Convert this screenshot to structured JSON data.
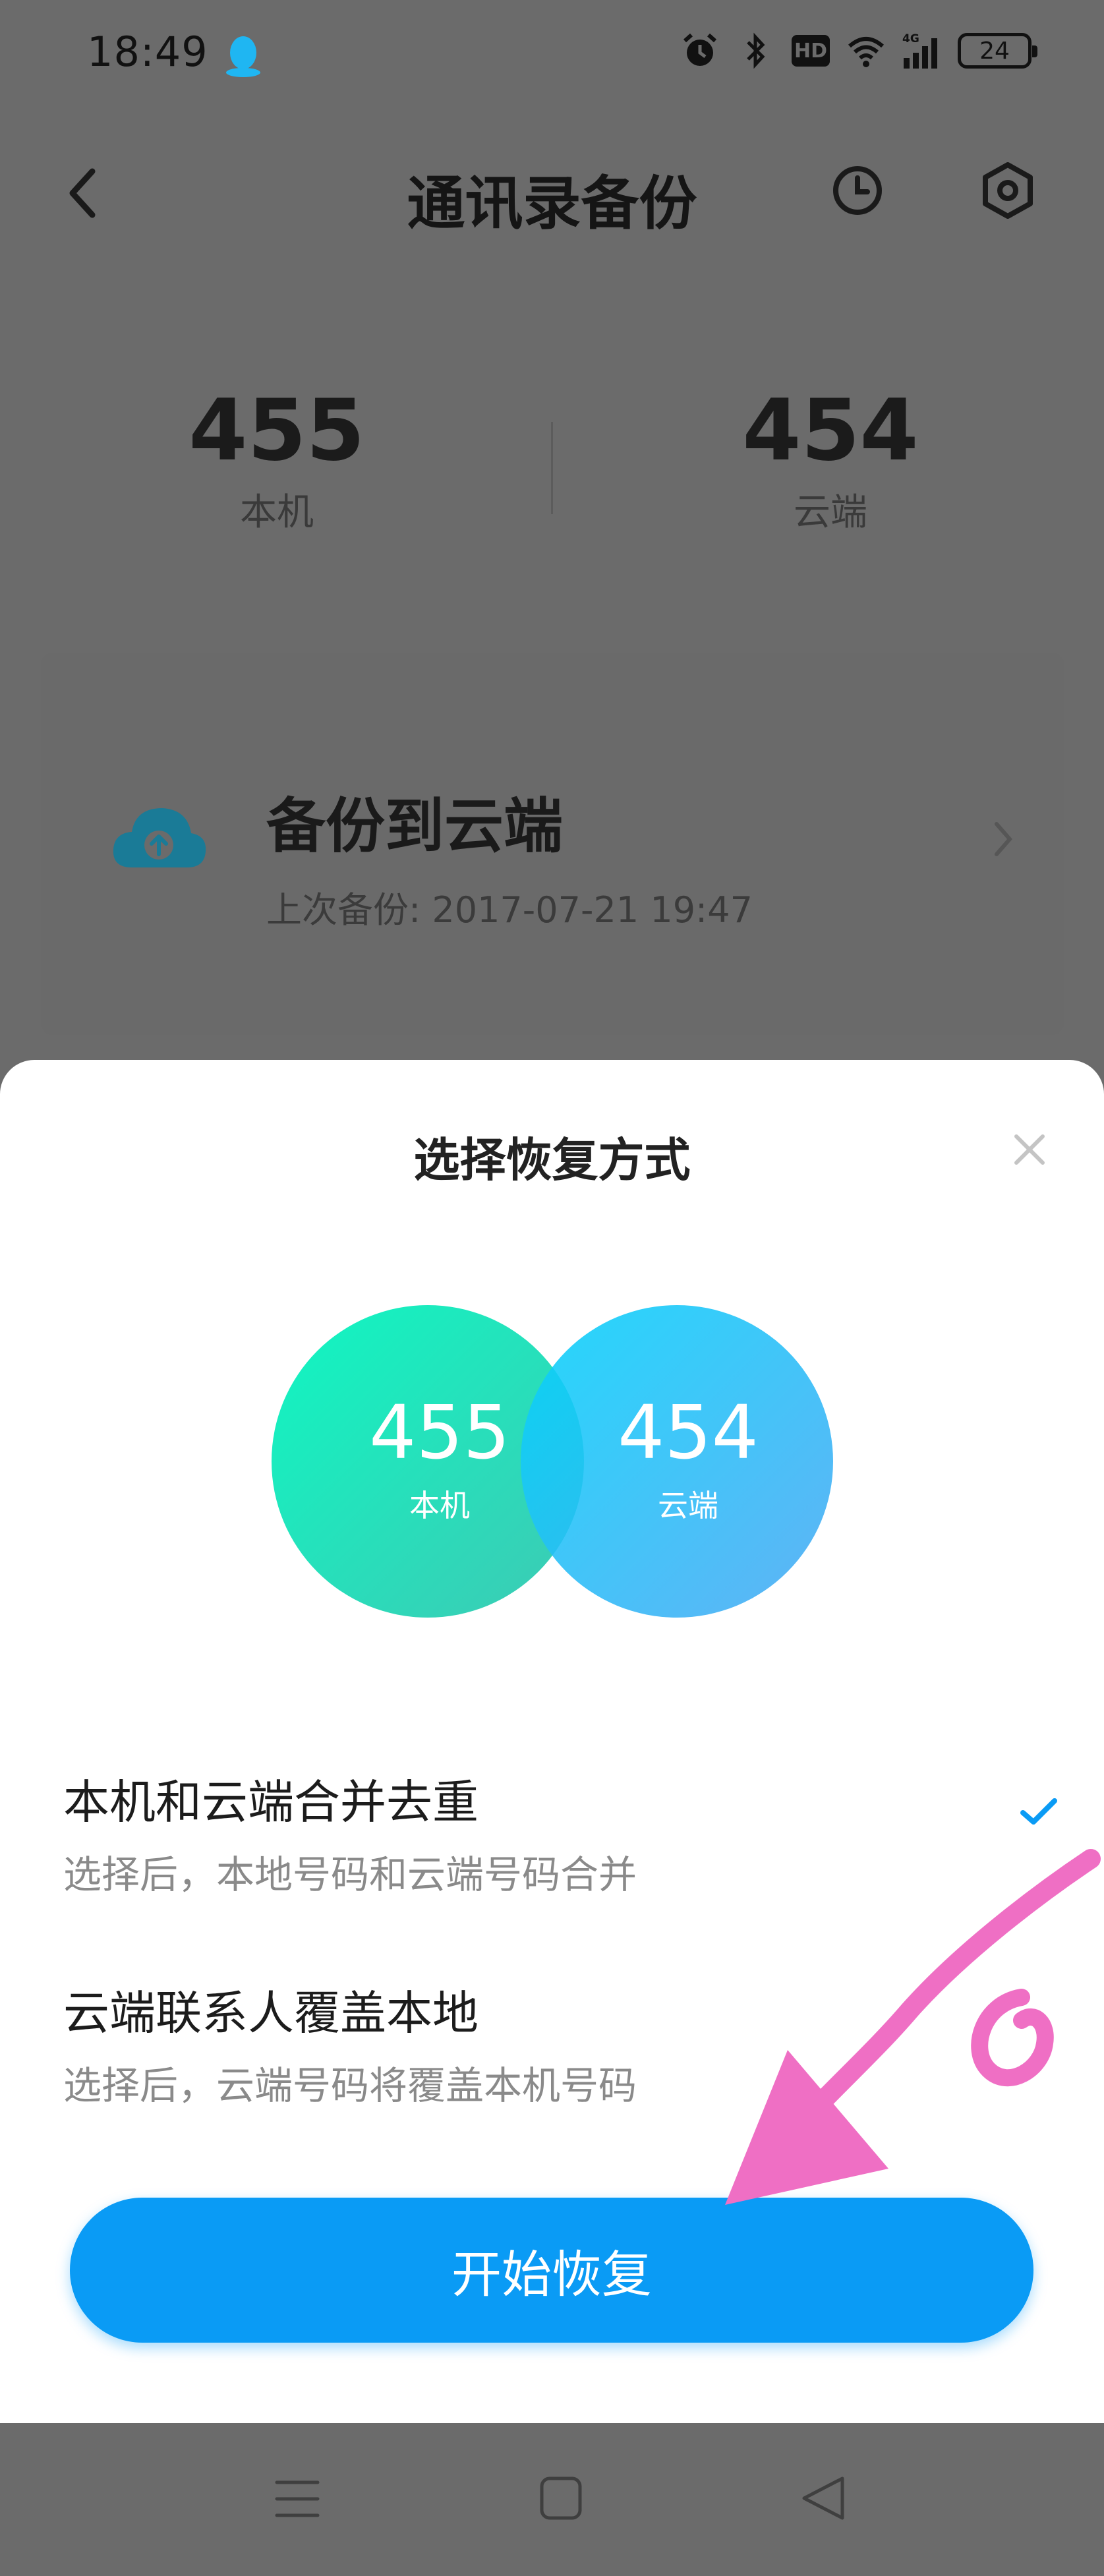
{
  "status_bar": {
    "time": "18:49",
    "battery": "24"
  },
  "header": {
    "title": "通讯录备份"
  },
  "counts": {
    "local": {
      "value": "455",
      "label": "本机"
    },
    "cloud": {
      "value": "454",
      "label": "云端"
    }
  },
  "backup_card": {
    "title": "备份到云端",
    "subtitle": "上次备份: 2017-07-21 19:47"
  },
  "sheet": {
    "title": "选择恢复方式",
    "venn": {
      "local": {
        "value": "455",
        "label": "本机"
      },
      "cloud": {
        "value": "454",
        "label": "云端"
      }
    },
    "options": [
      {
        "title": "本机和云端合并去重",
        "description": "选择后，本地号码和云端号码合并",
        "selected": true
      },
      {
        "title": "云端联系人覆盖本地",
        "description": "选择后，云端号码将覆盖本机号码",
        "selected": false
      }
    ],
    "button_label": "开始恢复"
  },
  "colors": {
    "accent": "#0a9bf5",
    "circle_local": "#10e8b8",
    "circle_cloud": "#12c3f7",
    "annotation": "#ef6fc4"
  },
  "icons": [
    "qq-icon",
    "alarm-icon",
    "bluetooth-icon",
    "hd-icon",
    "wifi-icon",
    "signal-4g-icon",
    "battery-icon",
    "back-icon",
    "history-icon",
    "settings-icon",
    "cloud-upload-icon",
    "chevron-right-icon",
    "close-icon",
    "check-icon",
    "menu-icon",
    "home-icon",
    "nav-back-icon"
  ]
}
